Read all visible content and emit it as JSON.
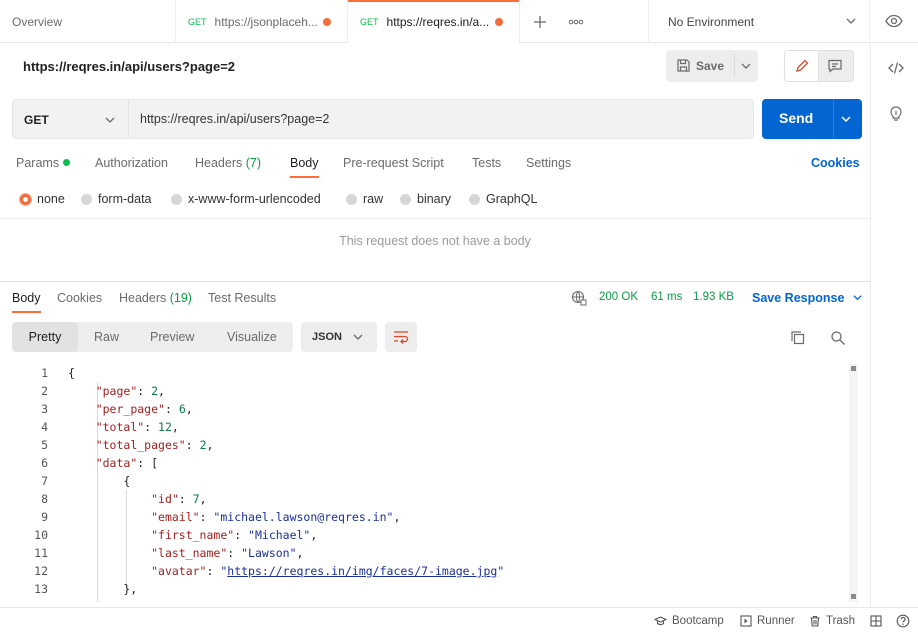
{
  "tabs": [
    {
      "title": "Overview",
      "method": "",
      "unsaved": false,
      "active": false
    },
    {
      "title": "https://jsonplaceh...",
      "method": "GET",
      "unsaved": true,
      "active": false
    },
    {
      "title": "https://reqres.in/a...",
      "method": "GET",
      "unsaved": true,
      "active": true
    }
  ],
  "environment": {
    "label": "No Environment"
  },
  "request": {
    "title": "https://reqres.in/api/users?page=2",
    "method": "GET",
    "url": "https://reqres.in/api/users?page=2",
    "save_label": "Save",
    "send_label": "Send",
    "tabs": {
      "params": "Params",
      "authorization": "Authorization",
      "headers": "Headers",
      "headers_count": "(7)",
      "body": "Body",
      "prerequest": "Pre-request Script",
      "tests": "Tests",
      "settings": "Settings"
    },
    "cookies_label": "Cookies",
    "body_types": [
      "none",
      "form-data",
      "x-www-form-urlencoded",
      "raw",
      "binary",
      "GraphQL"
    ],
    "selected_body_type": "none",
    "no_body_message": "This request does not have a body"
  },
  "response": {
    "tabs": {
      "body": "Body",
      "cookies": "Cookies",
      "headers": "Headers",
      "headers_count": "(19)",
      "test_results": "Test Results"
    },
    "status": "200 OK",
    "time": "61 ms",
    "size": "1.93 KB",
    "save_response_label": "Save Response",
    "views": [
      "Pretty",
      "Raw",
      "Preview",
      "Visualize"
    ],
    "active_view": "Pretty",
    "format": "JSON",
    "code_lines": [
      {
        "n": "1",
        "parts": [
          {
            "c": "p",
            "t": "{"
          }
        ]
      },
      {
        "n": "2",
        "parts": [
          {
            "c": "p",
            "t": "    "
          },
          {
            "c": "k",
            "t": "\"page\""
          },
          {
            "c": "p",
            "t": ": "
          },
          {
            "c": "n",
            "t": "2"
          },
          {
            "c": "p",
            "t": ","
          }
        ]
      },
      {
        "n": "3",
        "parts": [
          {
            "c": "p",
            "t": "    "
          },
          {
            "c": "k",
            "t": "\"per_page\""
          },
          {
            "c": "p",
            "t": ": "
          },
          {
            "c": "n",
            "t": "6"
          },
          {
            "c": "p",
            "t": ","
          }
        ]
      },
      {
        "n": "4",
        "parts": [
          {
            "c": "p",
            "t": "    "
          },
          {
            "c": "k",
            "t": "\"total\""
          },
          {
            "c": "p",
            "t": ": "
          },
          {
            "c": "n",
            "t": "12"
          },
          {
            "c": "p",
            "t": ","
          }
        ]
      },
      {
        "n": "5",
        "parts": [
          {
            "c": "p",
            "t": "    "
          },
          {
            "c": "k",
            "t": "\"total_pages\""
          },
          {
            "c": "p",
            "t": ": "
          },
          {
            "c": "n",
            "t": "2"
          },
          {
            "c": "p",
            "t": ","
          }
        ]
      },
      {
        "n": "6",
        "parts": [
          {
            "c": "p",
            "t": "    "
          },
          {
            "c": "k",
            "t": "\"data\""
          },
          {
            "c": "p",
            "t": ": ["
          }
        ]
      },
      {
        "n": "7",
        "parts": [
          {
            "c": "p",
            "t": "        {"
          }
        ]
      },
      {
        "n": "8",
        "parts": [
          {
            "c": "p",
            "t": "            "
          },
          {
            "c": "k",
            "t": "\"id\""
          },
          {
            "c": "p",
            "t": ": "
          },
          {
            "c": "n",
            "t": "7"
          },
          {
            "c": "p",
            "t": ","
          }
        ]
      },
      {
        "n": "9",
        "parts": [
          {
            "c": "p",
            "t": "            "
          },
          {
            "c": "k",
            "t": "\"email\""
          },
          {
            "c": "p",
            "t": ": "
          },
          {
            "c": "s",
            "t": "\"michael.lawson@reqres.in\""
          },
          {
            "c": "p",
            "t": ","
          }
        ]
      },
      {
        "n": "10",
        "parts": [
          {
            "c": "p",
            "t": "            "
          },
          {
            "c": "k",
            "t": "\"first_name\""
          },
          {
            "c": "p",
            "t": ": "
          },
          {
            "c": "s",
            "t": "\"Michael\""
          },
          {
            "c": "p",
            "t": ","
          }
        ]
      },
      {
        "n": "11",
        "parts": [
          {
            "c": "p",
            "t": "            "
          },
          {
            "c": "k",
            "t": "\"last_name\""
          },
          {
            "c": "p",
            "t": ": "
          },
          {
            "c": "s",
            "t": "\"Lawson\""
          },
          {
            "c": "p",
            "t": ","
          }
        ]
      },
      {
        "n": "12",
        "parts": [
          {
            "c": "p",
            "t": "            "
          },
          {
            "c": "k",
            "t": "\"avatar\""
          },
          {
            "c": "p",
            "t": ": "
          },
          {
            "c": "s",
            "t": "\""
          },
          {
            "c": "u",
            "t": "https://reqres.in/img/faces/7-image.jpg"
          },
          {
            "c": "s",
            "t": "\""
          }
        ]
      },
      {
        "n": "13",
        "parts": [
          {
            "c": "p",
            "t": "        },"
          }
        ]
      }
    ]
  },
  "statusbar": {
    "bootcamp": "Bootcamp",
    "runner": "Runner",
    "trash": "Trash"
  },
  "colors": {
    "accent": "#ff6c37",
    "primary": "#0265d2",
    "success": "#0c9c45"
  }
}
